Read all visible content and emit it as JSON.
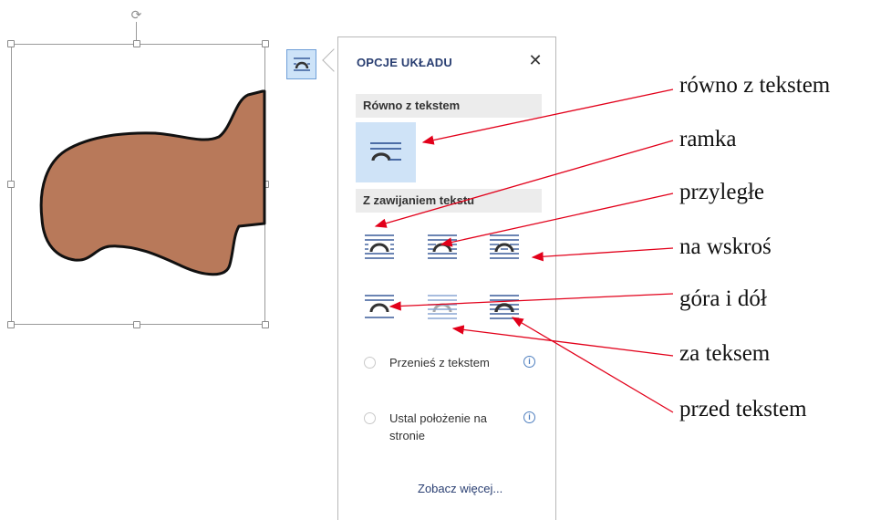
{
  "panel": {
    "title": "OPCJE UKŁADU",
    "close": "✕",
    "section_inline": "Równo z tekstem",
    "section_wrap": "Z zawijaniem tekstu",
    "radio_move": "Przenieś z tekstem",
    "radio_fix": "Ustal położenie na stronie",
    "info": "i",
    "see_more": "Zobacz więcej..."
  },
  "annotations": {
    "inline": "równo z tekstem",
    "square": "ramka",
    "tight": "przyległe",
    "through": "na wskroś",
    "top_bottom": "góra i dół",
    "behind": "za teksem",
    "front": "przed tekstem"
  },
  "colors": {
    "shape_fill": "#b8795a",
    "arrow": "#e2001a",
    "panel_accent": "#2a3f72",
    "selected_bg": "#cfe3f7"
  }
}
